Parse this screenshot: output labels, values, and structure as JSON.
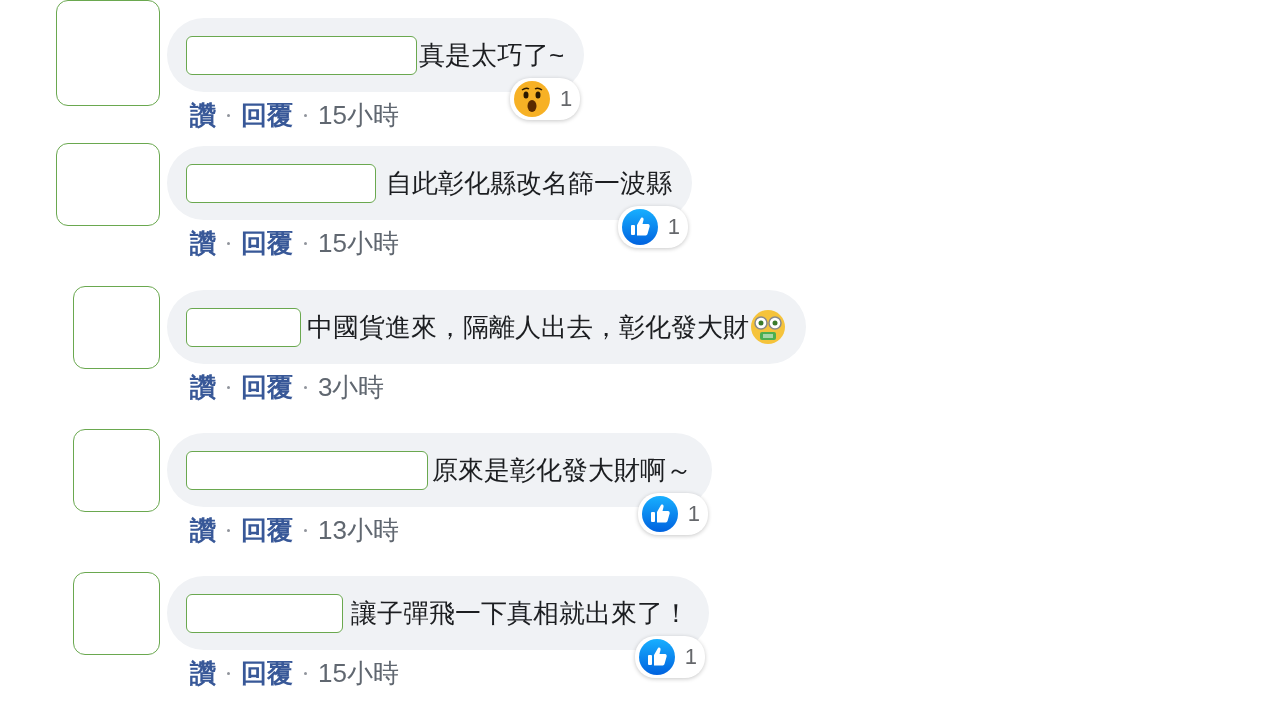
{
  "comments": [
    {
      "text": "真是太巧了~",
      "has_emoji": false,
      "actions": [
        "讚",
        "回覆"
      ],
      "time": "15小時",
      "reaction": {
        "kind": "wow",
        "count": "1"
      }
    },
    {
      "text": "自此彰化縣改名篩一波縣",
      "has_emoji": false,
      "actions": [
        "讚",
        "回覆"
      ],
      "time": "15小時",
      "reaction": {
        "kind": "like",
        "count": "1"
      }
    },
    {
      "text": "中國貨進來，隔離人出去，彰化發大財",
      "has_emoji": true,
      "actions": [
        "讚",
        "回覆"
      ],
      "time": "3小時"
    },
    {
      "text": "原來是彰化發大財啊～",
      "has_emoji": false,
      "actions": [
        "讚",
        "回覆"
      ],
      "time": "13小時",
      "reaction": {
        "kind": "like",
        "count": "1"
      }
    },
    {
      "text": "讓子彈飛一下真相就出來了！",
      "has_emoji": false,
      "actions": [
        "讚",
        "回覆"
      ],
      "time": "15小時",
      "reaction": {
        "kind": "like",
        "count": "1"
      }
    }
  ]
}
